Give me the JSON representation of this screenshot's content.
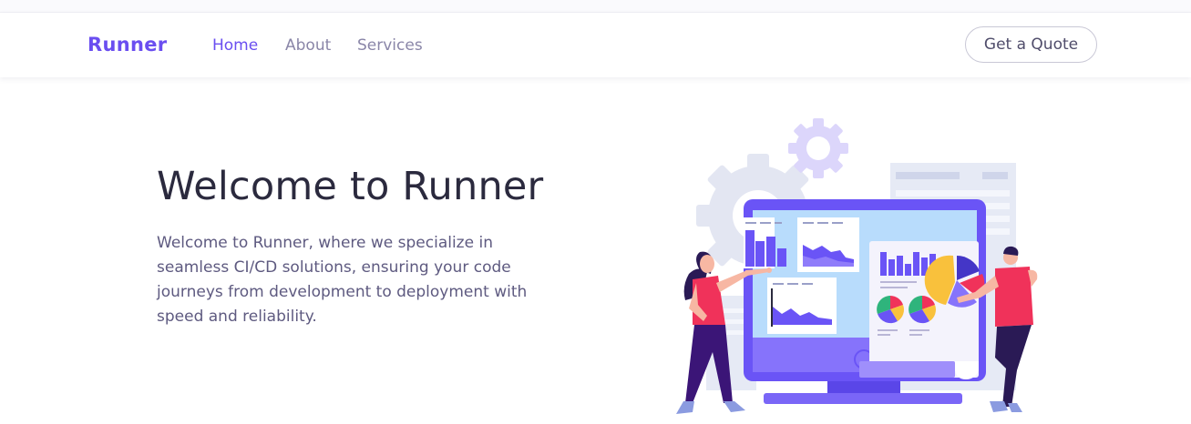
{
  "nav": {
    "brand": "Runner",
    "links": [
      {
        "label": "Home",
        "active": true
      },
      {
        "label": "About",
        "active": false
      },
      {
        "label": "Services",
        "active": false
      }
    ],
    "cta_label": "Get a Quote"
  },
  "hero": {
    "title": "Welcome to Runner",
    "description": "Welcome to Runner, where we specialize in seamless CI/CD solutions, ensuring your code journeys from development to deployment with speed and reliability."
  },
  "colors": {
    "brand": "#6a4ef0",
    "nav_text": "#8a86a8",
    "title_text": "#2b2a3e",
    "body_text": "#5e5a80",
    "accent_pink": "#f0325a",
    "illustration_purple": "#6a54f6"
  },
  "illustration": {
    "icon": "analytics-dashboard-illustration"
  }
}
